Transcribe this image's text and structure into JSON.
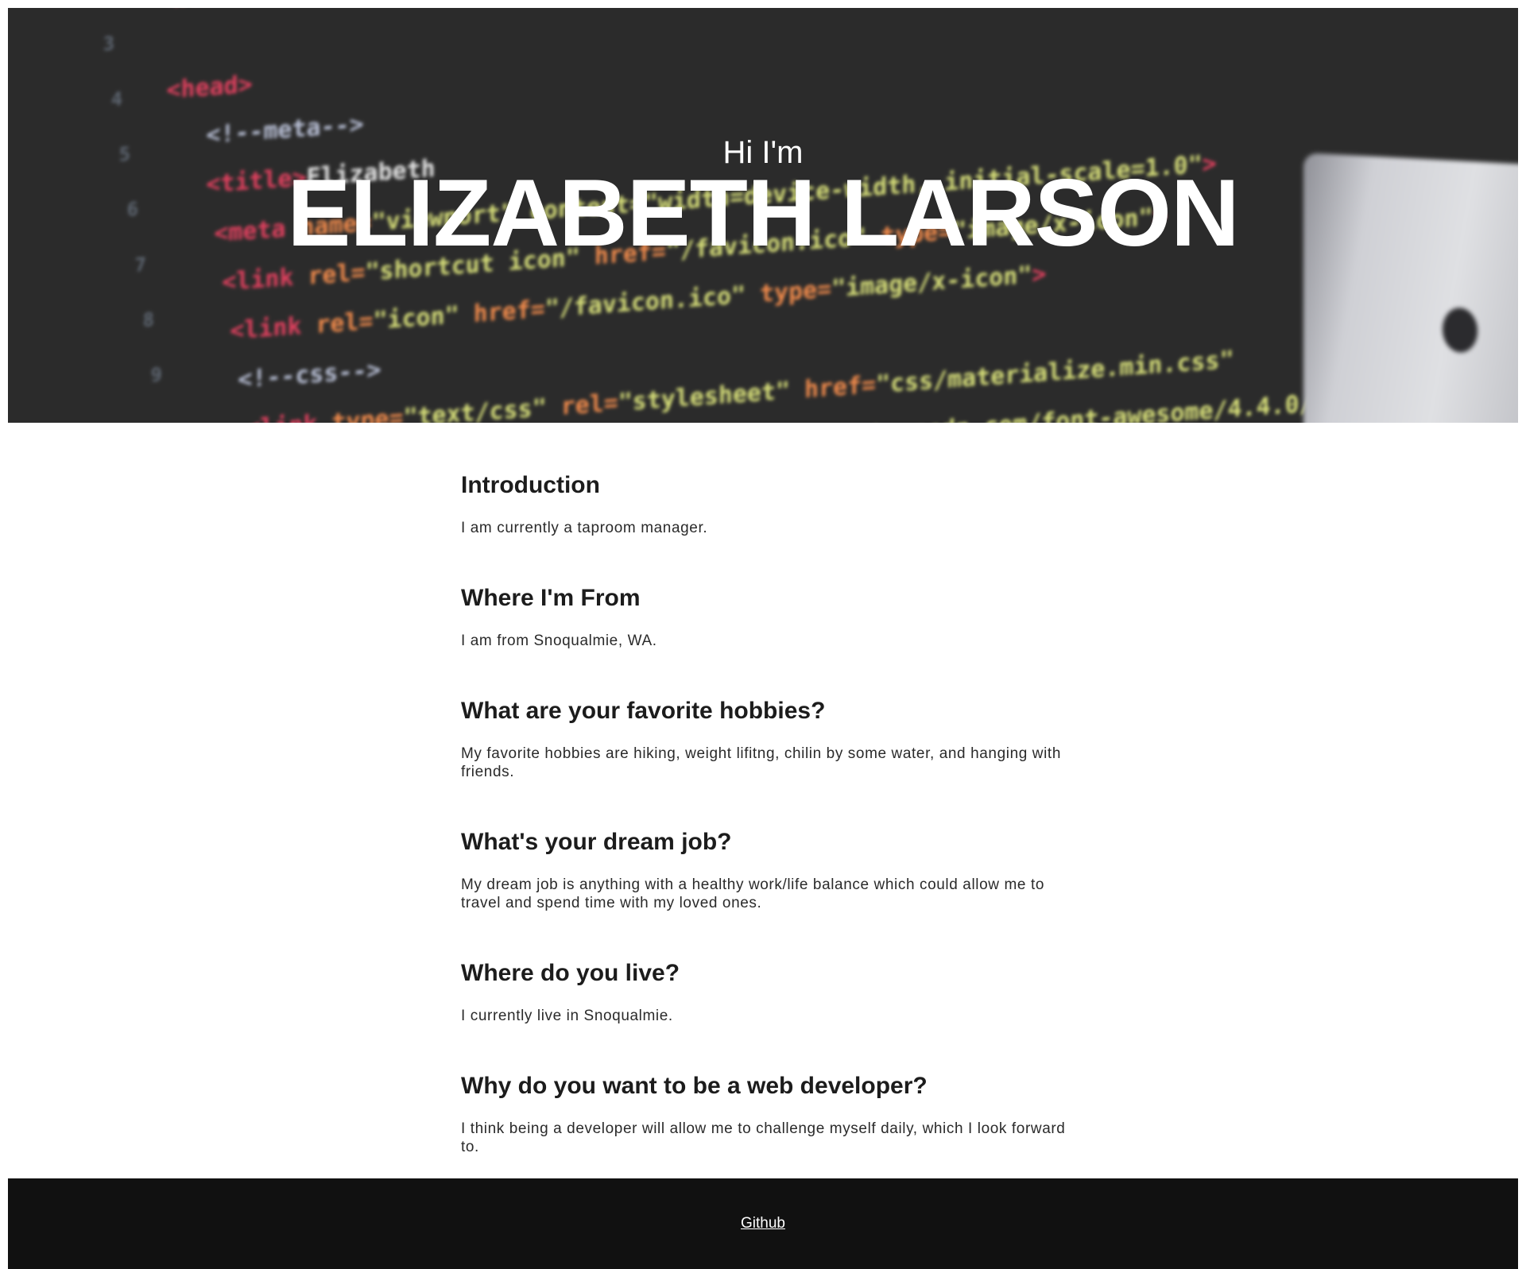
{
  "hero": {
    "greeting": "Hi I'm",
    "name": "ELIZABETH LARSON"
  },
  "sections": [
    {
      "heading": "Introduction",
      "body": "I am currently a taproom manager."
    },
    {
      "heading": "Where I'm From",
      "body": "I am from Snoqualmie, WA."
    },
    {
      "heading": "What are your favorite hobbies?",
      "body": "My favorite hobbies are hiking, weight lifitng, chilin by some water, and hanging with friends."
    },
    {
      "heading": "What's your dream job?",
      "body": "My dream job is anything with a healthy work/life balance which could allow me to travel and spend time with my loved ones."
    },
    {
      "heading": "Where do you live?",
      "body": "I currently live in Snoqualmie."
    },
    {
      "heading": "Why do you want to be a web developer?",
      "body": "I think being a developer will allow me to challenge myself daily, which I look forward to."
    }
  ],
  "footer": {
    "link_label": "Github"
  },
  "colors": {
    "hero_bg": "#2b2b2b",
    "footer_bg": "#111111",
    "text": "#1c1c1c"
  }
}
